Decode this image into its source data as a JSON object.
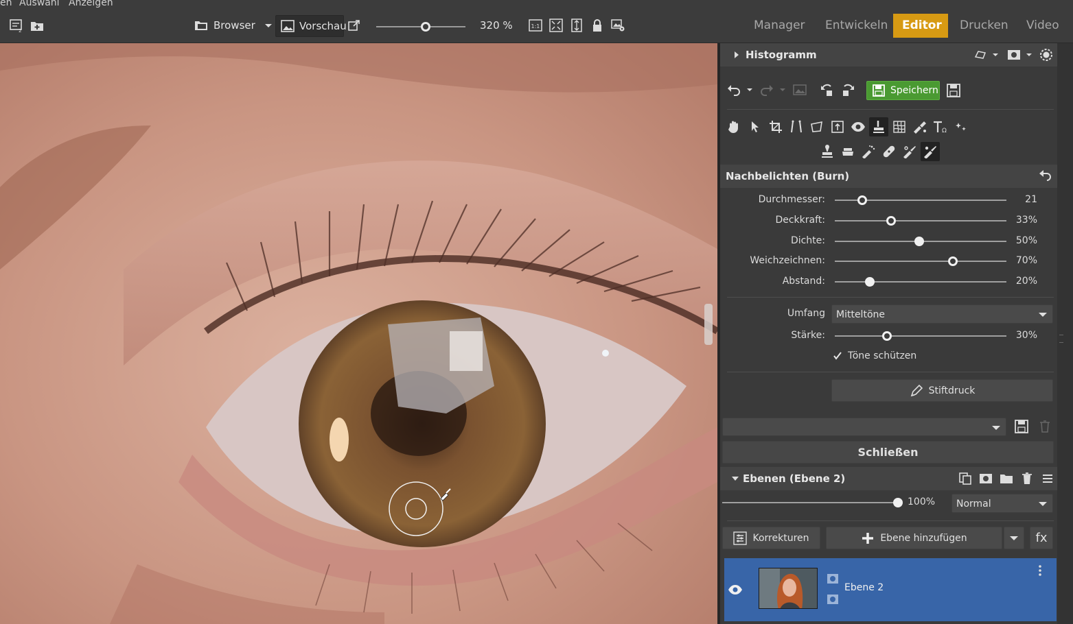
{
  "menubar": {
    "items": [
      "en",
      "Auswahl",
      "Anzeigen"
    ]
  },
  "toolbar": {
    "browser_label": "Browser",
    "vorschau_label": "Vorschau",
    "zoom_value": "320 %",
    "zoom_slider_fraction": 0.55,
    "ratio_label": "1:1",
    "modes": [
      {
        "label": "Manager",
        "active": false
      },
      {
        "label": "Entwickeln",
        "active": false
      },
      {
        "label": "Editor",
        "active": true
      },
      {
        "label": "Drucken",
        "active": false
      },
      {
        "label": "Video",
        "active": false
      }
    ],
    "accent_color": "#d79a13"
  },
  "panel": {
    "histogram_title": "Histogramm",
    "save_label": "Speichern",
    "save_color": "#4a9a32",
    "tool_title": "Nachbelichten (Burn)",
    "sliders": [
      {
        "label": "Durchmesser:",
        "value": "21",
        "fraction": 0.16
      },
      {
        "label": "Deckkraft:",
        "value": "33%",
        "fraction": 0.33
      },
      {
        "label": "Dichte:",
        "value": "50%",
        "fraction": 0.5
      },
      {
        "label": "Weichzeichnen:",
        "value": "70%",
        "fraction": 0.7
      },
      {
        "label": "Abstand:",
        "value": "20%",
        "fraction": 0.2
      }
    ],
    "umfang_label": "Umfang",
    "umfang_value": "Mitteltöne",
    "staerke_label": "Stärke:",
    "staerke_value": "30%",
    "staerke_fraction": 0.3,
    "protect_tones_label": "Töne schützen",
    "protect_tones_checked": true,
    "pen_pressure_label": "Stiftdruck",
    "preset_value": "",
    "close_label": "Schließen",
    "layers_title": "Ebenen (Ebene 2)",
    "opacity_value": "100%",
    "opacity_fraction": 1.0,
    "blend_mode": "Normal",
    "corrections_label": "Korrekturen",
    "add_layer_label": "Ebene hinzufügen",
    "fx_label": "fx",
    "layer_name": "Ebene 2",
    "layer_selected_color": "#3865a8"
  }
}
